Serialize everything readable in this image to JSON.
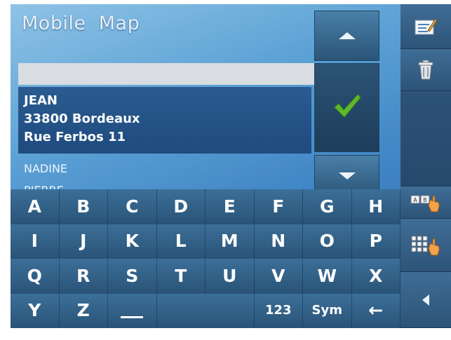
{
  "app": {
    "title": "Mobile  Map"
  },
  "search": {
    "value": ""
  },
  "selected_entry": {
    "line1": "JEAN",
    "line2": "33800 Bordeaux",
    "line3": "Rue Ferbos 11"
  },
  "list_items": [
    "NADINE",
    "PIERRE"
  ],
  "keyboard": {
    "row1": [
      "A",
      "B",
      "C",
      "D",
      "E",
      "F",
      "G",
      "H"
    ],
    "row2": [
      "I",
      "J",
      "K",
      "L",
      "M",
      "N",
      "O",
      "P"
    ],
    "row3": [
      "Q",
      "R",
      "S",
      "T",
      "U",
      "V",
      "W",
      "X"
    ],
    "row4": [
      "Y",
      "Z",
      "123",
      "Sym",
      "←"
    ]
  },
  "sidebar_icons": [
    "edit-icon",
    "trash-icon",
    "ab-keyboard-icon",
    "numeric-keypad-icon",
    "back-icon"
  ],
  "colors": {
    "accent_check": "#5fb82a",
    "selected_bg": "#1f4b7e"
  }
}
